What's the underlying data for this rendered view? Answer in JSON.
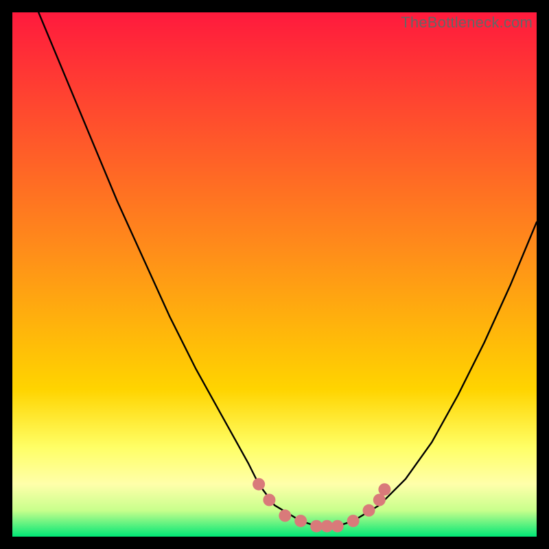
{
  "watermark": "TheBottleneck.com",
  "chart_data": {
    "type": "line",
    "title": "",
    "xlabel": "",
    "ylabel": "",
    "xlim": [
      0,
      100
    ],
    "ylim": [
      0,
      100
    ],
    "grid": false,
    "legend": false,
    "background_gradient": {
      "top_color": "#ff1a3d",
      "mid_color": "#ffd400",
      "bottom_color": "#00e676",
      "pale_band_color": "#ffffaa"
    },
    "series": [
      {
        "name": "bottleneck-curve",
        "color": "#000000",
        "x": [
          5,
          10,
          15,
          20,
          25,
          30,
          35,
          40,
          45,
          47,
          50,
          55,
          58,
          60,
          62,
          65,
          70,
          75,
          80,
          85,
          90,
          95,
          100
        ],
        "y": [
          100,
          88,
          76,
          64,
          53,
          42,
          32,
          23,
          14,
          10,
          6,
          3,
          2,
          2,
          2,
          3,
          6,
          11,
          18,
          27,
          37,
          48,
          60
        ]
      }
    ],
    "markers": {
      "name": "highlight-dots",
      "color": "#d97a7a",
      "points": [
        {
          "x": 47,
          "y": 10
        },
        {
          "x": 49,
          "y": 7
        },
        {
          "x": 52,
          "y": 4
        },
        {
          "x": 55,
          "y": 3
        },
        {
          "x": 58,
          "y": 2
        },
        {
          "x": 60,
          "y": 2
        },
        {
          "x": 62,
          "y": 2
        },
        {
          "x": 65,
          "y": 3
        },
        {
          "x": 68,
          "y": 5
        },
        {
          "x": 70,
          "y": 7
        },
        {
          "x": 71,
          "y": 9
        }
      ]
    }
  }
}
